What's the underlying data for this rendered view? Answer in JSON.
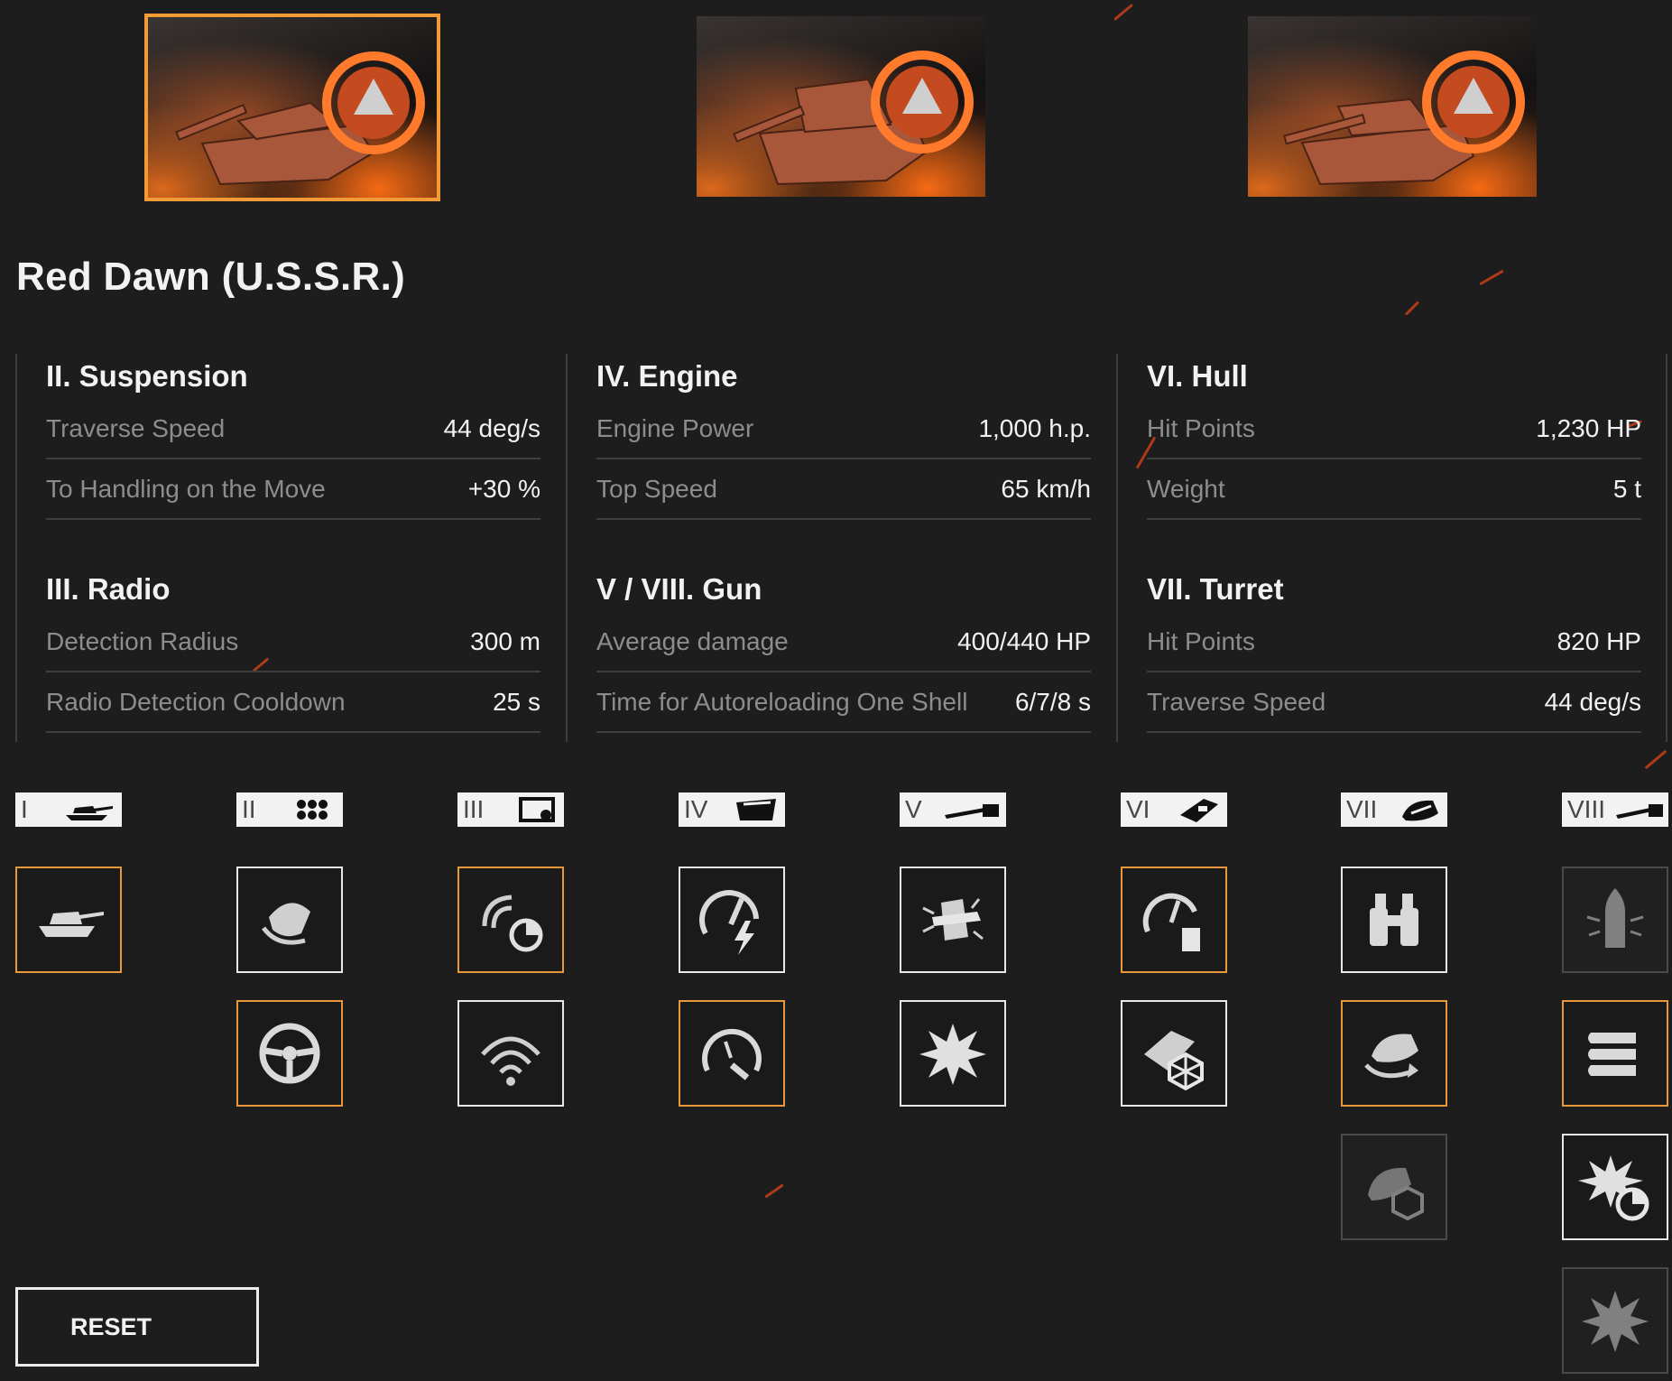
{
  "page_title": "Red Dawn (U.S.S.R.)",
  "variants": [
    {
      "name": "variant-1",
      "selected": true
    },
    {
      "name": "variant-2",
      "selected": false
    },
    {
      "name": "variant-3",
      "selected": false
    }
  ],
  "stats": {
    "suspension": {
      "title": "II. Suspension",
      "rows": [
        {
          "label": "Traverse Speed",
          "value": "44 deg/s"
        },
        {
          "label": "To Handling on the Move",
          "value": "+30 %"
        }
      ]
    },
    "radio": {
      "title": "III. Radio",
      "rows": [
        {
          "label": "Detection Radius",
          "value": "300 m"
        },
        {
          "label": "Radio Detection Cooldown",
          "value": "25 s"
        }
      ]
    },
    "engine": {
      "title": "IV. Engine",
      "rows": [
        {
          "label": "Engine Power",
          "value": "1,000 h.p."
        },
        {
          "label": "Top Speed",
          "value": "65 km/h"
        }
      ]
    },
    "gun": {
      "title": "V / VIII. Gun",
      "rows": [
        {
          "label": "Average damage",
          "value": "400/440 HP"
        },
        {
          "label": "Time for Autoreloading One Shell",
          "value": "6/7/8 s"
        }
      ]
    },
    "hull": {
      "title": "VI. Hull",
      "rows": [
        {
          "label": "Hit Points",
          "value": "1,230 HP"
        },
        {
          "label": "Weight",
          "value": "5 t"
        }
      ]
    },
    "turret": {
      "title": "VII. Turret",
      "rows": [
        {
          "label": "Hit Points",
          "value": "820 HP"
        },
        {
          "label": "Traverse Speed",
          "value": "44 deg/s"
        }
      ]
    }
  },
  "tiers": [
    {
      "numeral": "I",
      "icon": "tank-icon",
      "modules": [
        {
          "icon": "tank-hull-icon",
          "state": "selected"
        }
      ]
    },
    {
      "numeral": "II",
      "icon": "track-icon",
      "modules": [
        {
          "icon": "suspension-traverse-icon",
          "state": "normal"
        },
        {
          "icon": "steering-wheel-icon",
          "state": "selected"
        }
      ]
    },
    {
      "numeral": "III",
      "icon": "radio-icon",
      "modules": [
        {
          "icon": "radio-cooldown-icon",
          "state": "selected"
        },
        {
          "icon": "radio-range-icon",
          "state": "normal"
        }
      ]
    },
    {
      "numeral": "IV",
      "icon": "engine-icon",
      "modules": [
        {
          "icon": "engine-power-icon",
          "state": "normal"
        },
        {
          "icon": "speedometer-icon",
          "state": "selected"
        }
      ]
    },
    {
      "numeral": "V",
      "icon": "gun-icon",
      "modules": [
        {
          "icon": "armor-piercing-icon",
          "state": "normal"
        },
        {
          "icon": "explosion-icon",
          "state": "normal"
        }
      ]
    },
    {
      "numeral": "VI",
      "icon": "hull-icon",
      "modules": [
        {
          "icon": "hull-weight-icon",
          "state": "selected"
        },
        {
          "icon": "hull-armor-icon",
          "state": "normal"
        }
      ]
    },
    {
      "numeral": "VII",
      "icon": "turret-icon",
      "modules": [
        {
          "icon": "binoculars-icon",
          "state": "normal"
        },
        {
          "icon": "turret-traverse-icon",
          "state": "selected"
        },
        {
          "icon": "turret-armor-icon",
          "state": "dim"
        }
      ]
    },
    {
      "numeral": "VIII",
      "icon": "gun-icon",
      "modules": [
        {
          "icon": "shell-icon",
          "state": "dim"
        },
        {
          "icon": "magazine-icon",
          "state": "selected"
        },
        {
          "icon": "reload-burst-icon",
          "state": "normal"
        },
        {
          "icon": "explosion-icon",
          "state": "dim"
        }
      ]
    }
  ],
  "reset_label": "RESET",
  "colors": {
    "accent": "#f29a35",
    "background": "#1d1d1e",
    "tile_border": "#e8e8e8"
  }
}
